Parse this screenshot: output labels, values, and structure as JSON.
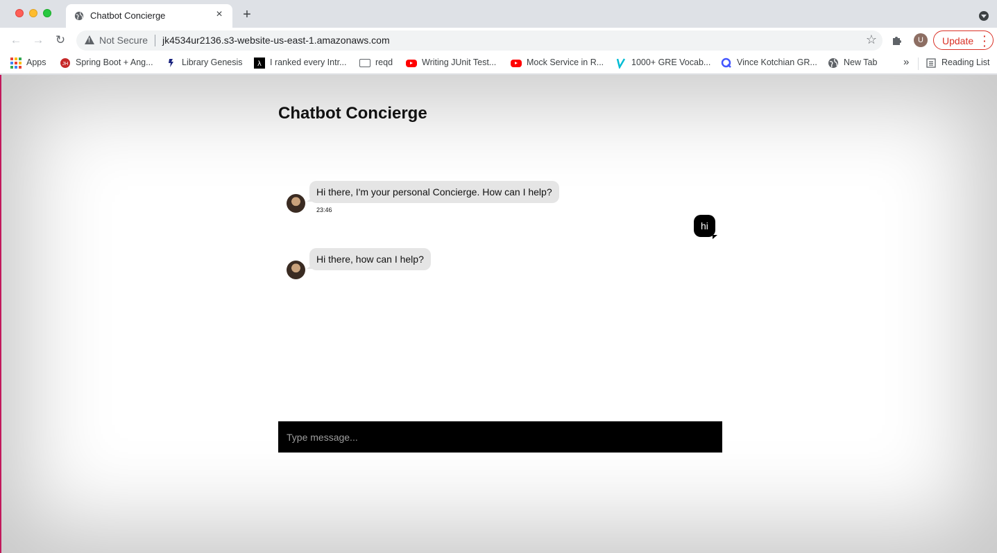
{
  "browser": {
    "tab": {
      "title": "Chatbot Concierge",
      "close": "×"
    },
    "new_tab": "+",
    "omnibox": {
      "security": "Not Secure",
      "url": "jk4534ur2136.s3-website-us-east-1.amazonaws.com"
    },
    "profile_initial": "U",
    "update_label": "Update",
    "bookmarks": [
      {
        "label": "Apps",
        "icon": "apps-grid-icon"
      },
      {
        "label": "Spring Boot + Ang...",
        "icon": "spring-icon"
      },
      {
        "label": "Library Genesis",
        "icon": "libgen-icon"
      },
      {
        "label": "I ranked every Intr...",
        "icon": "lambda-icon"
      },
      {
        "label": "reqd",
        "icon": "folder-icon"
      },
      {
        "label": "Writing JUnit Test...",
        "icon": "youtube-icon"
      },
      {
        "label": "Mock Service in R...",
        "icon": "youtube-icon"
      },
      {
        "label": "1000+ GRE Vocab...",
        "icon": "vocab-icon"
      },
      {
        "label": "Vince Kotchian GR...",
        "icon": "quizlet-icon"
      },
      {
        "label": "New Tab",
        "icon": "globe-icon"
      }
    ],
    "bookmarks_more": "»",
    "reading_list": "Reading List",
    "colors": {
      "update_red": "#d93025",
      "chrome_bg": "#dee1e6"
    }
  },
  "chat": {
    "title": "Chatbot Concierge",
    "messages": [
      {
        "sender": "bot",
        "text": "Hi there, I'm your personal Concierge. How can I help?",
        "time": "23:46"
      },
      {
        "sender": "user",
        "text": "hi"
      },
      {
        "sender": "bot",
        "text": "Hi there, how can I help?"
      }
    ],
    "input_placeholder": "Type message..."
  }
}
